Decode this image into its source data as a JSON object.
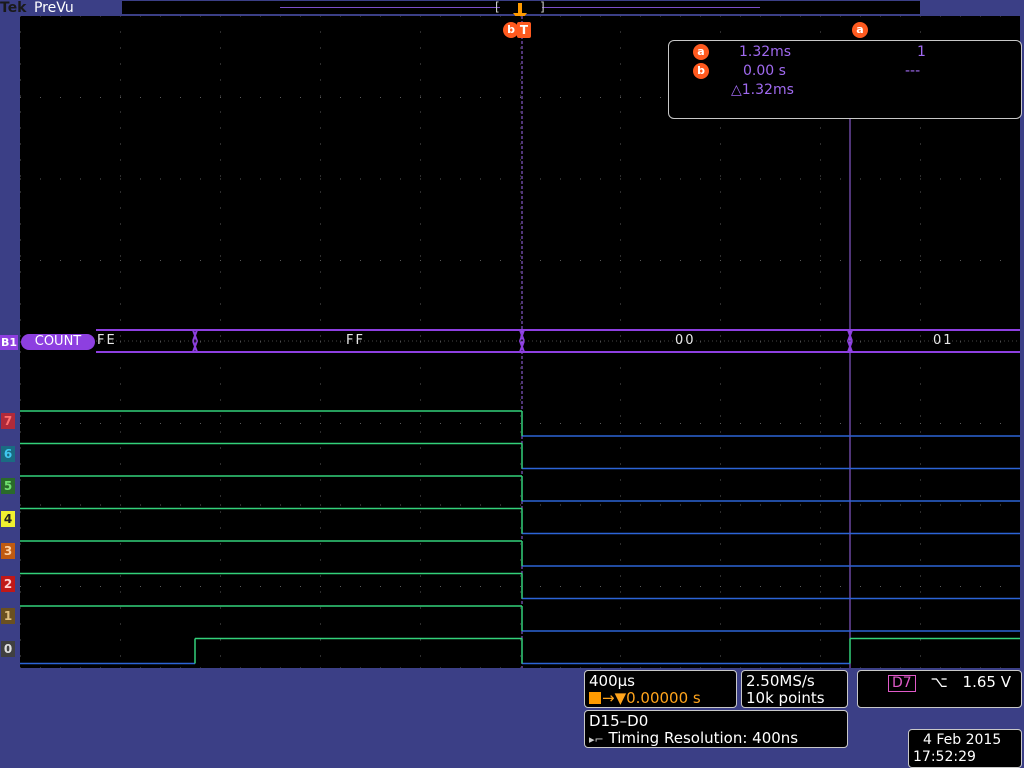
{
  "brand": {
    "logo": "Tek",
    "mode": "PreVu"
  },
  "colors": {
    "background": "#3b3f86",
    "screen": "#000000",
    "bus": "#8d3fe0",
    "trace_high": "#33d17a",
    "trace_low": "#2c64d6",
    "cursor": "#a06af0",
    "marker": "#ff5a1f",
    "trigger_text": "#ffa41c"
  },
  "markers": {
    "b_label": "b",
    "t_label": "T",
    "a_label": "a"
  },
  "readout": {
    "a_time": "1.32ms",
    "a_value": "1",
    "b_time": "0.00 s",
    "b_value": "---",
    "delta": "△1.32ms"
  },
  "bus": {
    "id": "B1",
    "label": "COUNT",
    "values": [
      "FE",
      "FF",
      "00",
      "01"
    ]
  },
  "channels": [
    {
      "label": "7",
      "color": "#b02a3a",
      "text": "#ff7070"
    },
    {
      "label": "6",
      "color": "#1a6b82",
      "text": "#40c8f0"
    },
    {
      "label": "5",
      "color": "#2a6a2a",
      "text": "#70e070"
    },
    {
      "label": "4",
      "color": "#f0f030",
      "text": "#222222"
    },
    {
      "label": "3",
      "color": "#c05a10",
      "text": "#ffd0a0"
    },
    {
      "label": "2",
      "color": "#c01818",
      "text": "#ffd0d0"
    },
    {
      "label": "1",
      "color": "#6a5020",
      "text": "#e0c080"
    },
    {
      "label": "0",
      "color": "#404040",
      "text": "#e0e0e0"
    }
  ],
  "horizontal": {
    "scale": "400µs",
    "trigger_position": "0.00000 s"
  },
  "acquisition": {
    "rate": "2.50MS/s",
    "record": "10k points"
  },
  "trigger": {
    "source": "D7",
    "slope": "⌥",
    "level": "1.65 V"
  },
  "digital": {
    "group": "D15–D0",
    "resolution": "Timing Resolution: 400ns"
  },
  "datetime": {
    "date": "4 Feb  2015",
    "time": "17:52:29"
  }
}
